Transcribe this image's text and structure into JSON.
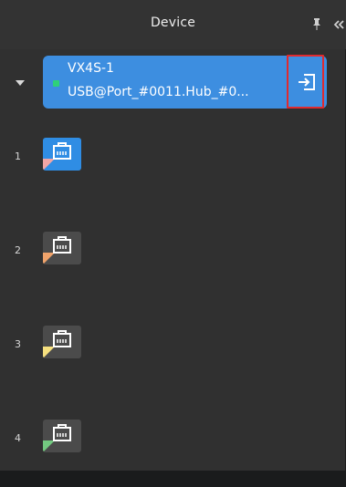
{
  "header": {
    "title": "Device",
    "pin_icon": "pin-icon",
    "collapse_icon": "double-chevron-left-icon"
  },
  "device": {
    "name": "VX4S-1",
    "path": "USB@Port_#0011.Hub_#0...",
    "status_color": "#2fd07a",
    "card_color": "#3d8ee0",
    "enter_icon": "enter-icon"
  },
  "ports": [
    {
      "number": "1",
      "icon": "ethernet-port-icon",
      "active": true,
      "corner_color": "#f0a6a6"
    },
    {
      "number": "2",
      "icon": "ethernet-port-icon",
      "active": false,
      "corner_color": "#f0a36b"
    },
    {
      "number": "3",
      "icon": "ethernet-port-icon",
      "active": false,
      "corner_color": "#f6e07f"
    },
    {
      "number": "4",
      "icon": "ethernet-port-icon",
      "active": false,
      "corner_color": "#73c980"
    }
  ],
  "colors": {
    "panel_bg": "#303030",
    "highlight_border": "#e02a2e",
    "active_tile": "#2f8de4",
    "inactive_tile": "#4b4b4b"
  }
}
